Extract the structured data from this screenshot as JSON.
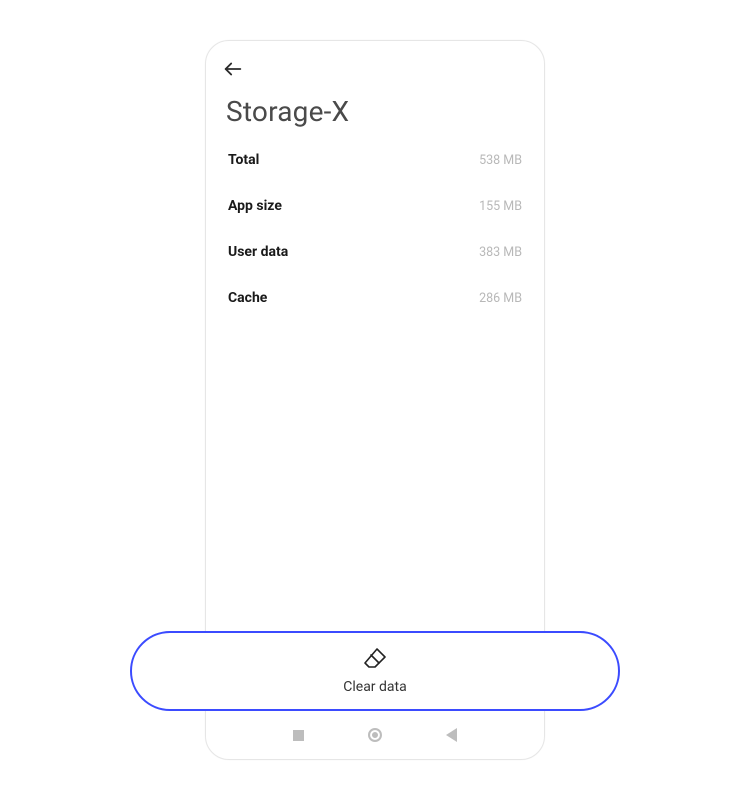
{
  "header": {
    "title": "Storage-X"
  },
  "storage": {
    "rows": [
      {
        "label": "Total",
        "value": "538 MB"
      },
      {
        "label": "App size",
        "value": "155 MB"
      },
      {
        "label": "User data",
        "value": "383 MB"
      },
      {
        "label": "Cache",
        "value": "286 MB"
      }
    ]
  },
  "actions": {
    "clear_data_label": "Clear data"
  }
}
